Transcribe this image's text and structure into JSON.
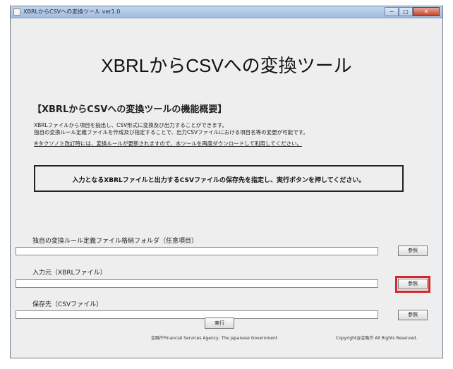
{
  "window": {
    "title": "XBRLからCSVへの変換ツール ver1.0",
    "minimize_label": "─",
    "maximize_label": "□",
    "close_label": "✕"
  },
  "main": {
    "title": "XBRLからCSVへの変換ツール",
    "overview_heading": "【XBRLからCSVへの変換ツールの機能概要】",
    "description_line1": "XBRLファイルから項目を抽出し、CSV形式に変換及び出力することができます。",
    "description_line2": "独自の変換ルール定義ファイルを作成及び指定することで、出力CSVファイルにおける項目名等の変更が可能です。",
    "note": "※タクソノミ改訂時には、変換ルールが更新されますので、本ツールを再度ダウンロードして利用してください。",
    "instruction": "入力となるXBRLファイルと出力するCSVファイルの保存先を指定し、実行ボタンを押してください。"
  },
  "fields": [
    {
      "label": "独自の変換ルール定義ファイル格納フォルダ（任意項目）",
      "value": "",
      "button": "参照"
    },
    {
      "label": "入力元（XBRLファイル）",
      "value": "",
      "button": "参照"
    },
    {
      "label": "保存先（CSVファイル）",
      "value": "",
      "button": "参照"
    }
  ],
  "run_button": "実行",
  "footer": {
    "agency": "金融庁Financial Services Agency, The Japanese Government",
    "copyright": "Copyright@金融庁 All Rights Reserved."
  },
  "colors": {
    "highlight": "#d6262e",
    "window_bg": "#eeeeee"
  }
}
